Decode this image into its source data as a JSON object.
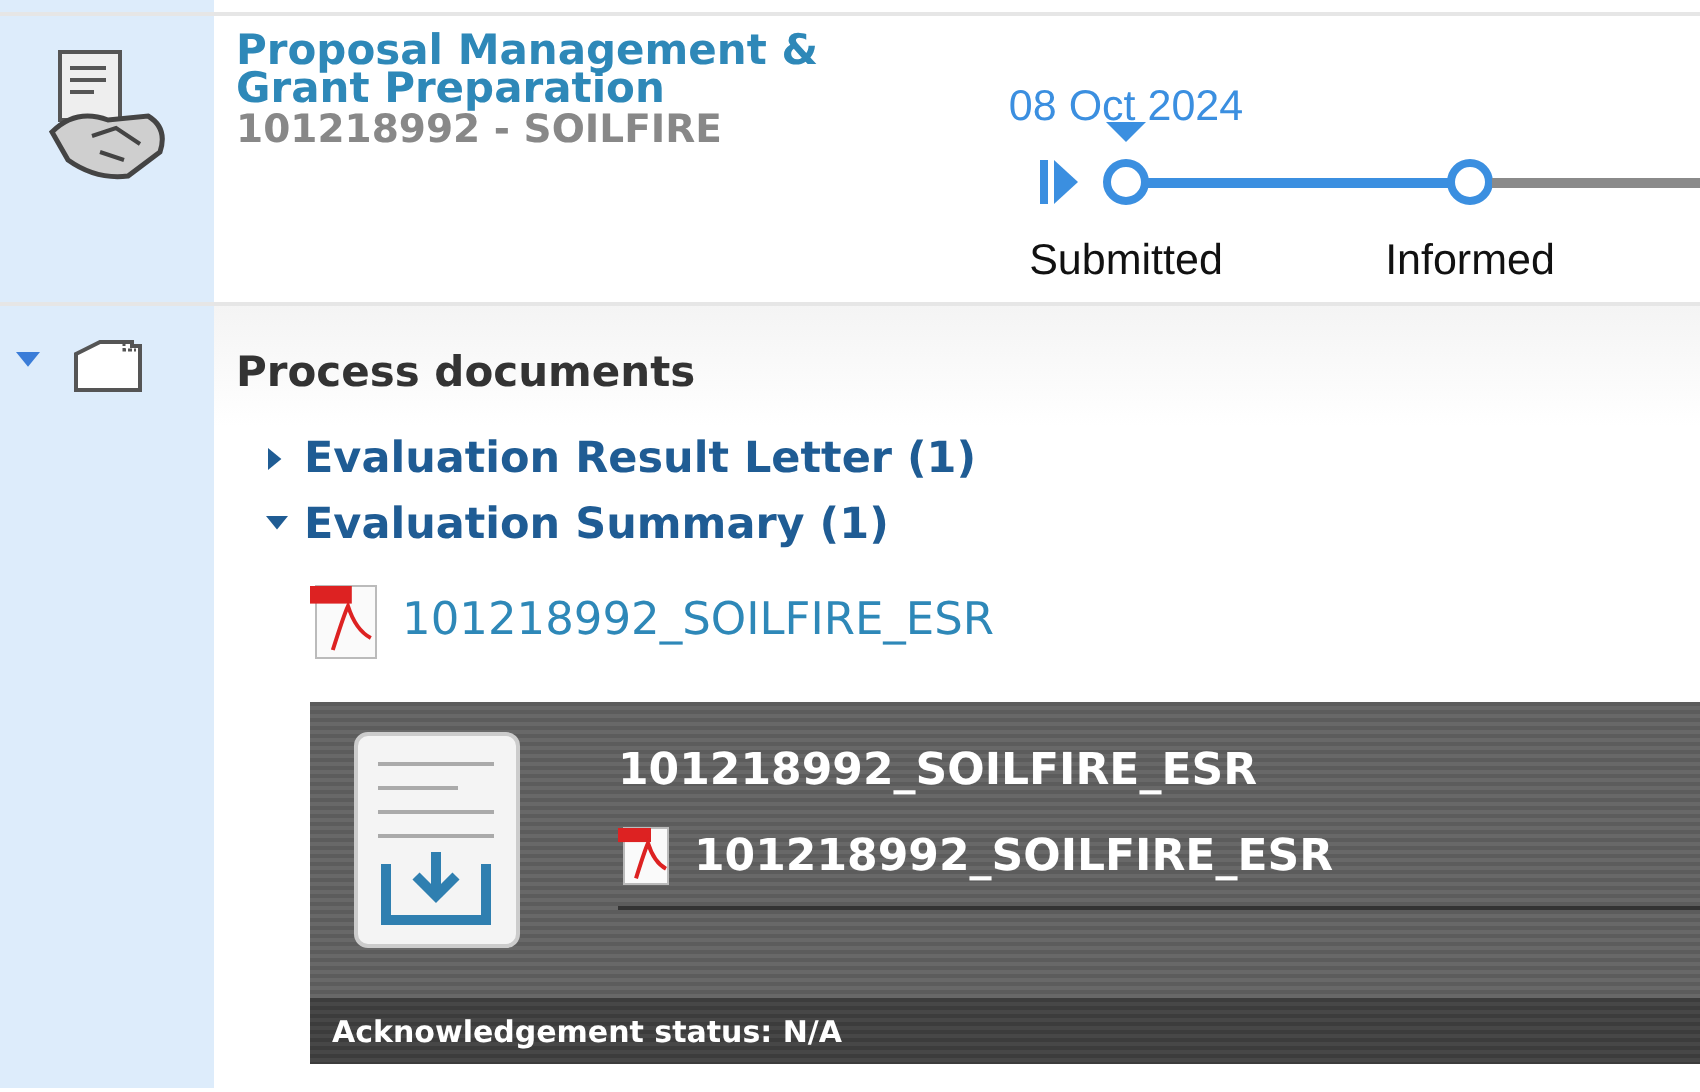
{
  "header": {
    "title_lines": [
      "Proposal Management &",
      "Grant Preparation"
    ],
    "subtitle": "101218992 - SOILFIRE"
  },
  "timeline": {
    "steps": [
      {
        "label": "Submitted",
        "reached": true,
        "current": true,
        "date": "08 Oct 2024"
      },
      {
        "label": "Informed",
        "reached": true,
        "current": false
      }
    ],
    "continues_reached": false
  },
  "documents": {
    "expanded": true,
    "title": "Process documents",
    "groups": [
      {
        "label": "Evaluation Result Letter (1)",
        "expanded": false
      },
      {
        "label": "Evaluation Summary (1)",
        "expanded": true,
        "files": [
          "101218992_SOILFIRE_ESR"
        ]
      }
    ]
  },
  "preview": {
    "title": "101218992_SOILFIRE_ESR",
    "file": "101218992_SOILFIRE_ESR",
    "ack_status": "Acknowledgement status: N/A"
  }
}
